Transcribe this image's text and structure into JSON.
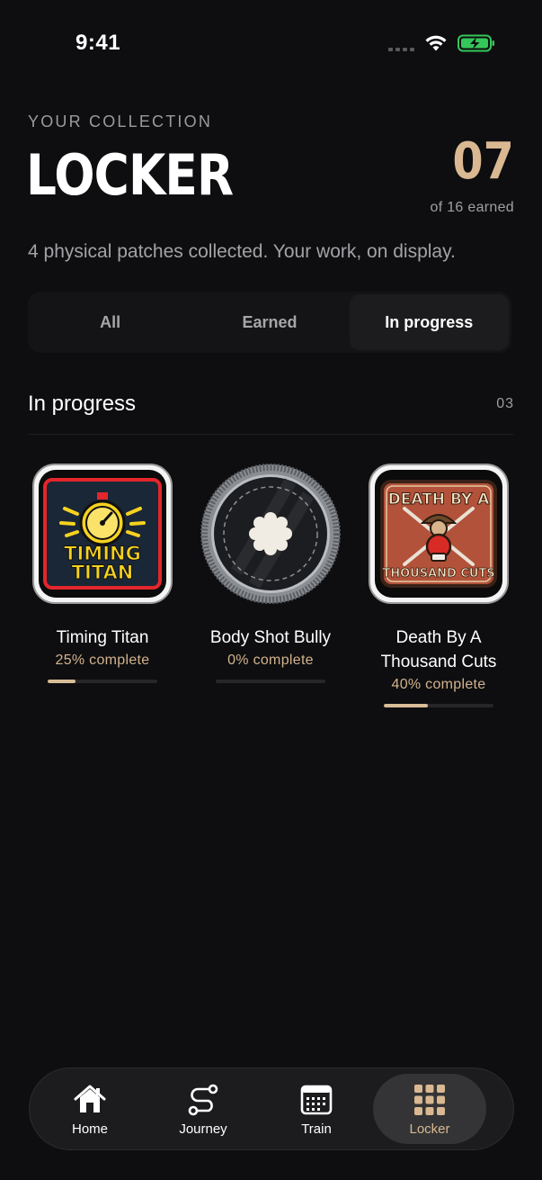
{
  "status": {
    "time": "9:41"
  },
  "header": {
    "eyebrow": "YOUR COLLECTION",
    "title": "LOCKER",
    "count": "07",
    "count_sub": "of 16 earned",
    "subtitle": "4 physical patches collected. Your work, on display."
  },
  "filters": [
    "All",
    "Earned",
    "In progress"
  ],
  "active_filter": "In progress",
  "section": {
    "title": "In progress",
    "count": "03"
  },
  "patches": [
    {
      "name": "Timing Titan",
      "progress_label": "25% complete",
      "progress": 0.25,
      "icon": "timing-titan-patch",
      "art_lines": [
        "TIMING",
        "TITAN"
      ]
    },
    {
      "name": "Body Shot Bully",
      "progress_label": "0% complete",
      "progress": 0.0,
      "icon": "locked-patch"
    },
    {
      "name": "Death By A Thousand Cuts",
      "progress_label": "40% complete",
      "progress": 0.4,
      "icon": "death-by-a-thousand-cuts-patch",
      "art_lines": [
        "DEATH BY A",
        "THOUSAND CUTS"
      ]
    }
  ],
  "tabs": [
    {
      "label": "Home",
      "icon": "home-icon"
    },
    {
      "label": "Journey",
      "icon": "journey-icon"
    },
    {
      "label": "Train",
      "icon": "calendar-icon"
    },
    {
      "label": "Locker",
      "icon": "grid-icon"
    }
  ],
  "active_tab": "Locker",
  "colors": {
    "accent": "#d9b892",
    "background": "#0e0e10"
  }
}
